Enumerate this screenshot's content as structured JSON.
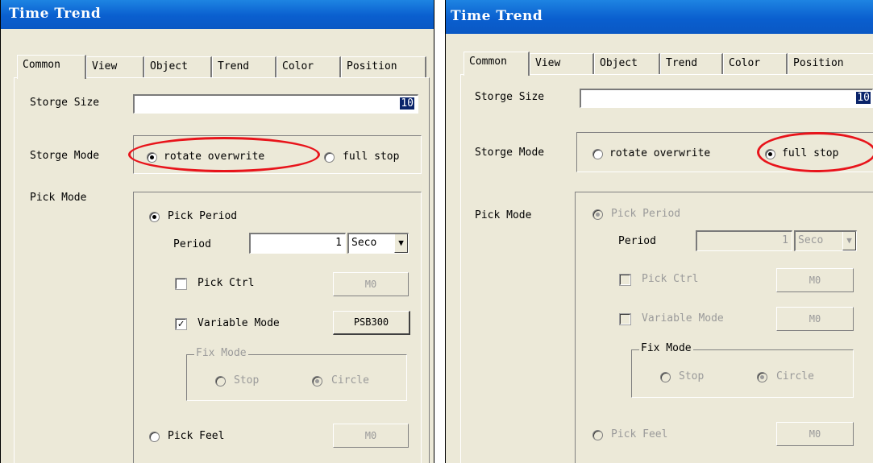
{
  "left": {
    "title": "Time Trend",
    "tabs": [
      "Common",
      "View",
      "Object",
      "Trend",
      "Color",
      "Position"
    ],
    "storge_size_label": "Storge Size",
    "storge_size_value": "10",
    "storge_mode_label": "Storge Mode",
    "rotate_overwrite": "rotate overwrite",
    "full_stop": "full stop",
    "pick_mode_label": "Pick Mode",
    "pick_period": "Pick Period",
    "period_label": "Period",
    "period_value": "1",
    "period_unit": "Seco",
    "pick_ctrl": "Pick Ctrl",
    "pick_ctrl_button": "M0",
    "variable_mode": "Variable Mode",
    "variable_mode_button": "PSB300",
    "fix_mode": "Fix Mode",
    "stop": "Stop",
    "circle": "Circle",
    "pick_feel": "Pick Feel",
    "pick_feel_button": "M0"
  },
  "right": {
    "title": "Time Trend",
    "tabs": [
      "Common",
      "View",
      "Object",
      "Trend",
      "Color",
      "Position"
    ],
    "storge_size_label": "Storge Size",
    "storge_size_value": "10",
    "storge_mode_label": "Storge Mode",
    "rotate_overwrite": "rotate overwrite",
    "full_stop": "full stop",
    "pick_mode_label": "Pick Mode",
    "pick_period": "Pick Period",
    "period_label": "Period",
    "period_value": "1",
    "period_unit": "Seco",
    "pick_ctrl": "Pick Ctrl",
    "pick_ctrl_button": "M0",
    "variable_mode": "Variable Mode",
    "variable_mode_button": "M0",
    "fix_mode": "Fix Mode",
    "stop": "Stop",
    "circle": "Circle",
    "pick_feel": "Pick Feel",
    "pick_feel_button": "M0"
  },
  "colors": {
    "titlebar": "#0a5fcf",
    "highlight_oval": "#e8141b",
    "dialog_bg": "#ece9d8"
  }
}
